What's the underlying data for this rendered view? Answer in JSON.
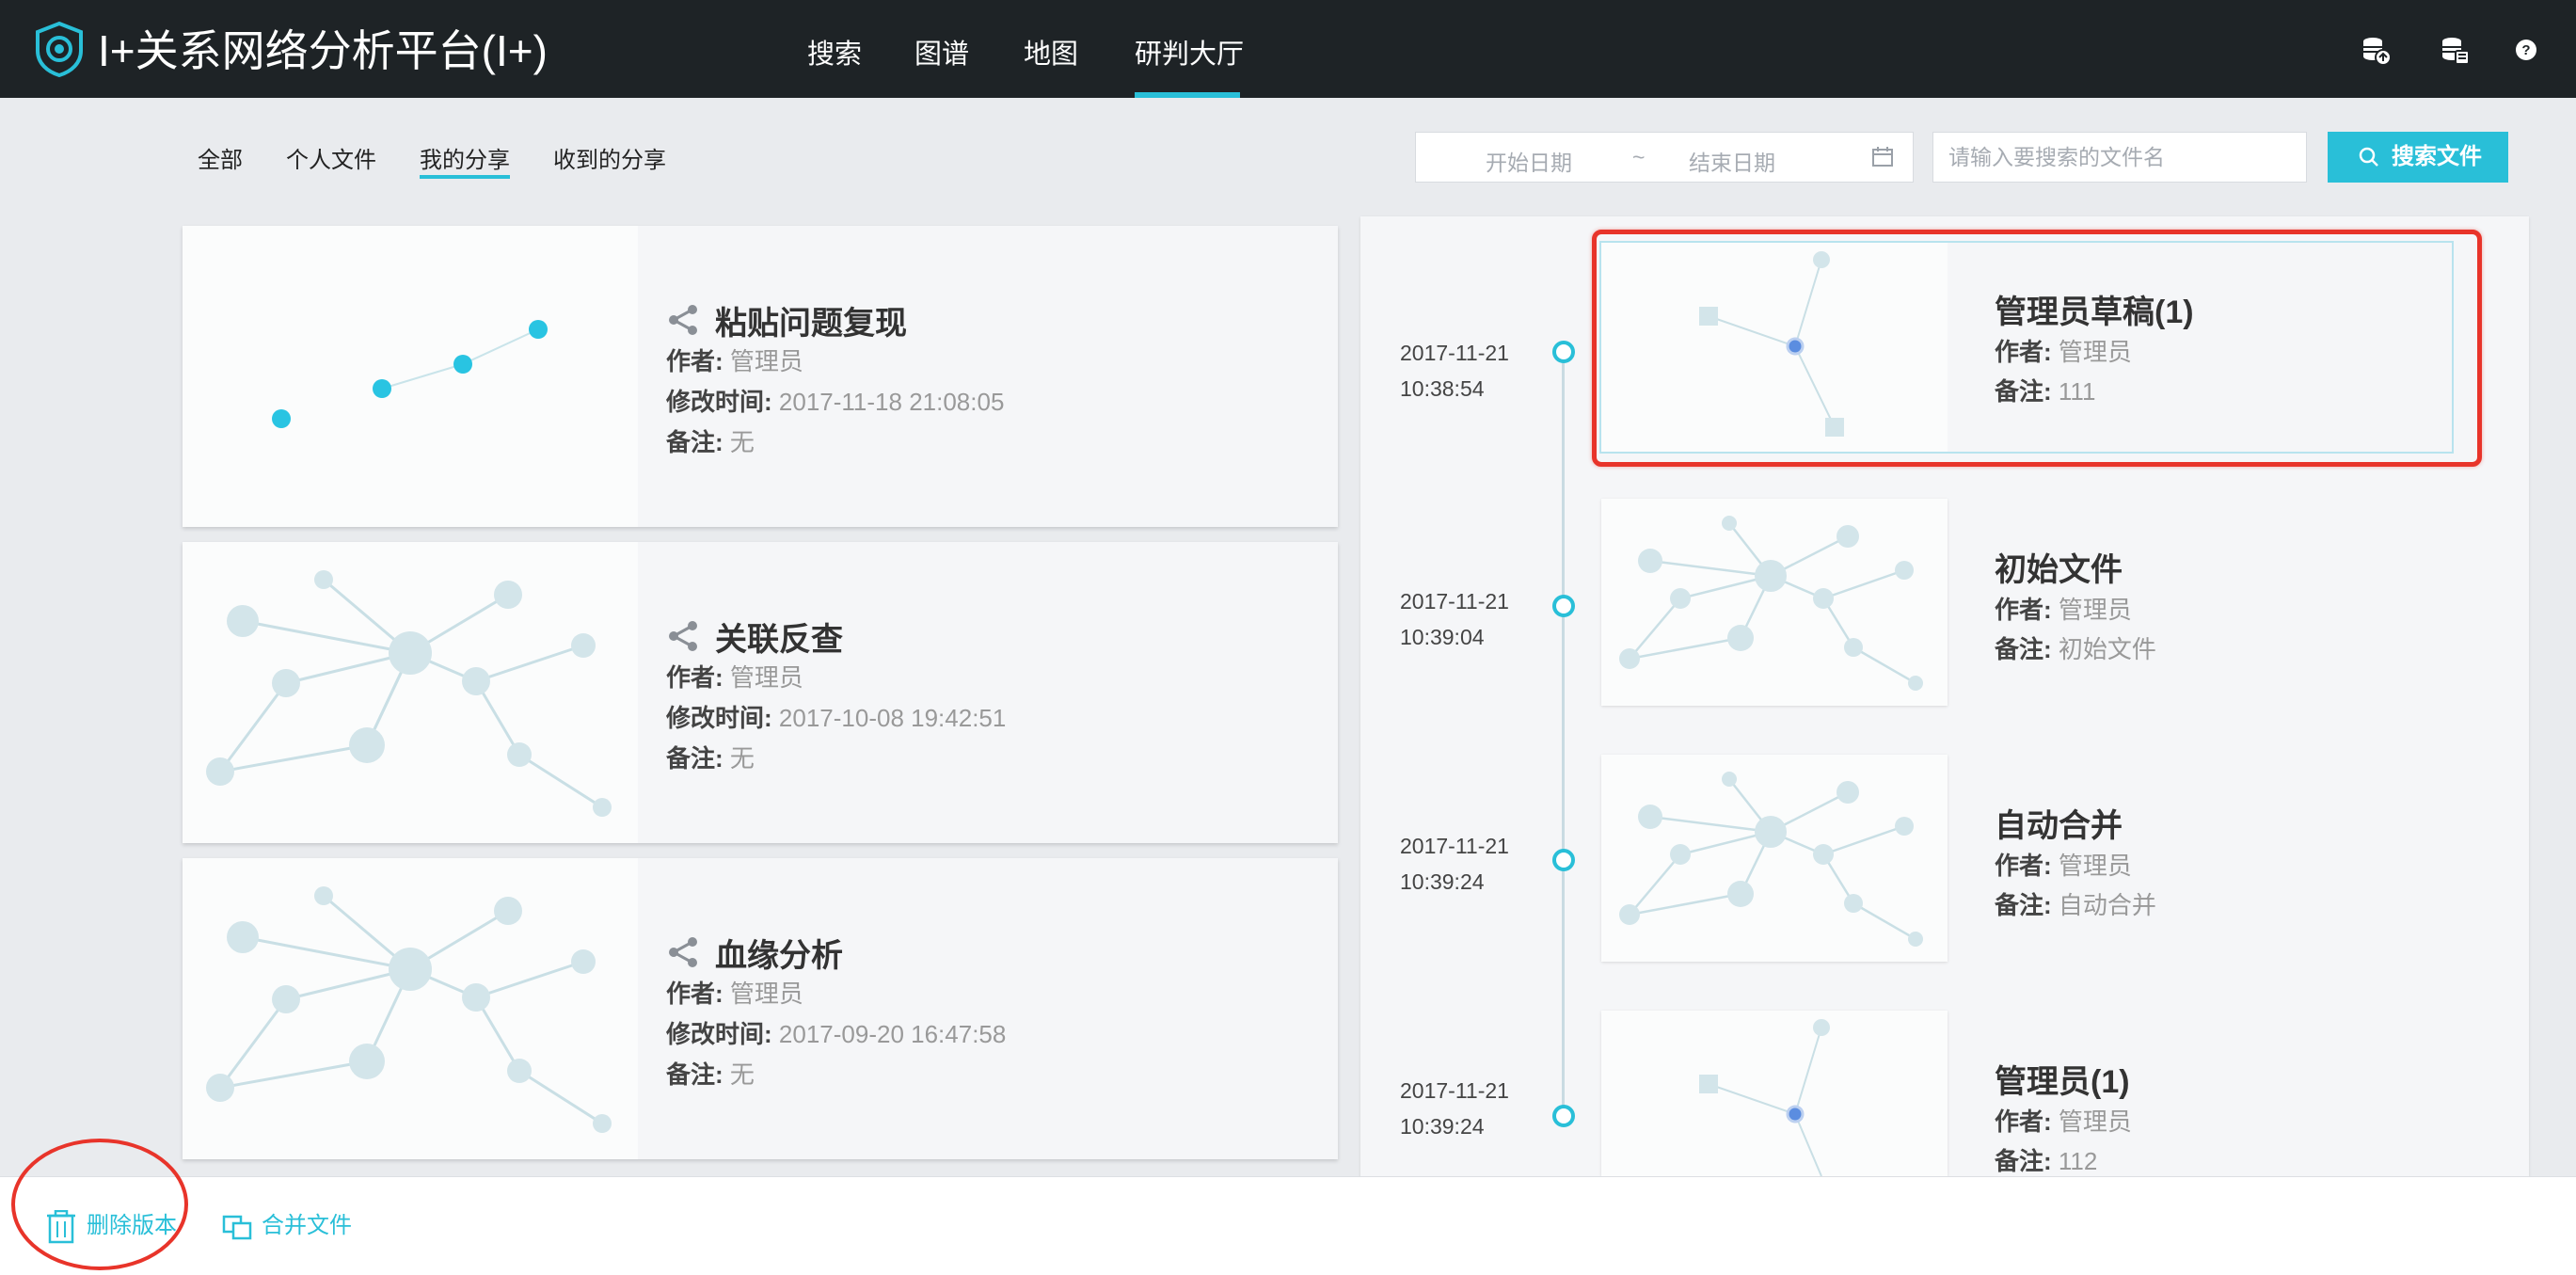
{
  "header": {
    "app_title": "I+关系网络分析平台(I+)",
    "nav": [
      "搜索",
      "图谱",
      "地图",
      "研判大厅"
    ],
    "active_nav": "研判大厅",
    "accent_color": "#29bfd8",
    "icons": [
      "database-upload-icon",
      "database-list-icon",
      "help-icon"
    ]
  },
  "subtabs": {
    "items": [
      "全部",
      "个人文件",
      "我的分享",
      "收到的分享"
    ],
    "active": "我的分享"
  },
  "filter": {
    "start_date_placeholder": "开始日期",
    "separator": "~",
    "end_date_placeholder": "结束日期",
    "search_placeholder": "请输入要搜索的文件名",
    "search_button": "搜索文件"
  },
  "labels": {
    "author": "作者:",
    "modified": "修改时间:",
    "note": "备注:"
  },
  "files": [
    {
      "title": "粘贴问题复现",
      "author": "管理员",
      "modified": "2017-11-18 21:08:05",
      "note": "无"
    },
    {
      "title": "关联反查",
      "author": "管理员",
      "modified": "2017-10-08 19:42:51",
      "note": "无"
    },
    {
      "title": "血缘分析",
      "author": "管理员",
      "modified": "2017-09-20 16:47:58",
      "note": "无"
    }
  ],
  "versions": [
    {
      "date": "2017-11-21",
      "time": "10:38:54",
      "title": "管理员草稿(1)",
      "author": "管理员",
      "note": "111"
    },
    {
      "date": "2017-11-21",
      "time": "10:39:04",
      "title": "初始文件",
      "author": "管理员",
      "note": "初始文件"
    },
    {
      "date": "2017-11-21",
      "time": "10:39:24",
      "title": "自动合并",
      "author": "管理员",
      "note": "自动合并"
    },
    {
      "date": "2017-11-21",
      "time": "10:39:24",
      "title": "管理员(1)",
      "author": "管理员",
      "note": "112"
    }
  ],
  "bottom": {
    "delete_version": "删除版本",
    "merge_files": "合并文件"
  }
}
